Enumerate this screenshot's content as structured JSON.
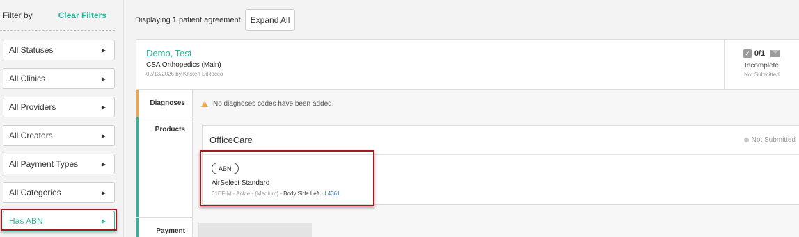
{
  "sidebar": {
    "title": "Filter by",
    "clear_label": "Clear Filters",
    "filters": [
      {
        "label": "All Statuses"
      },
      {
        "label": "All Clinics"
      },
      {
        "label": "All Providers"
      },
      {
        "label": "All Creators"
      },
      {
        "label": "All Payment Types"
      },
      {
        "label": "All Categories"
      },
      {
        "label": "Has ABN"
      }
    ],
    "active_filter": "Has ABN"
  },
  "topbar": {
    "displaying_prefix": "Displaying",
    "count": "1",
    "displaying_suffix": "patient agreement",
    "expand_label": "Expand All"
  },
  "agreement": {
    "patient_name": "Demo, Test",
    "clinic": "CSA Orthopedics (Main)",
    "created": "02/13/2026 by Kristen DiRocco",
    "status": {
      "count": "0/1",
      "main": "Incomplete",
      "sub": "Not Submitted"
    },
    "diagnoses": {
      "label": "Diagnoses",
      "message": "No diagnoses codes have been added."
    },
    "products": {
      "label": "Products",
      "vendor": "OfficeCare",
      "vendor_status": "Not Submitted",
      "items": [
        {
          "badge": "ABN",
          "name": "AirSelect Standard",
          "desc": "01EF-M - Ankle - (Medium) -",
          "side": "Body Side Left",
          "sep": "-",
          "code": "L4361"
        }
      ]
    },
    "payment": {
      "label": "Payment"
    }
  },
  "colors": {
    "accent": "#2fb59a",
    "warning": "#f0a640",
    "highlight": "#a01c22",
    "link": "#3a78c3"
  }
}
